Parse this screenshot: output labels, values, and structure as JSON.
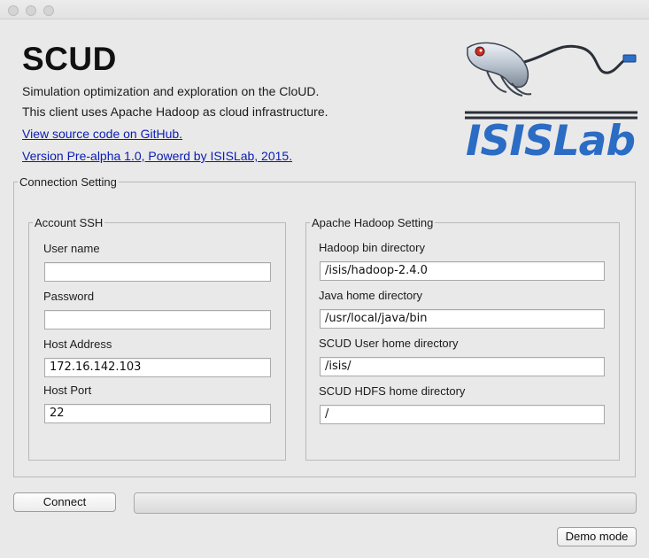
{
  "app": {
    "title": "SCUD",
    "description_line1": "Simulation optimization and exploration on the CloUD.",
    "description_line2": "This client uses Apache Hadoop as cloud infrastructure.",
    "link_github": "View source code on GitHub.",
    "link_version": "Version Pre-alpha 1.0, Powerd by ISISLab, 2015."
  },
  "logo": {
    "text": "ISISLab",
    "brand_color": "#2b6cc4"
  },
  "connection": {
    "group_label": "Connection Setting",
    "ssh": {
      "group_label": "Account SSH",
      "username_label": "User name",
      "username_value": "",
      "password_label": "Password",
      "password_value": "",
      "host_label": "Host Address",
      "host_value": "172.16.142.103",
      "port_label": "Host Port",
      "port_value": "22"
    },
    "hadoop": {
      "group_label": "Apache Hadoop Setting",
      "bin_label": "Hadoop bin directory",
      "bin_value": "/isis/hadoop-2.4.0",
      "java_label": "Java home directory",
      "java_value": "/usr/local/java/bin",
      "user_home_label": "SCUD User home directory",
      "user_home_value": "/isis/",
      "hdfs_home_label": "SCUD HDFS home directory",
      "hdfs_home_value": "/"
    }
  },
  "actions": {
    "connect_label": "Connect",
    "demo_label": "Demo mode",
    "progress_fraction": 0
  },
  "colors": {
    "link": "#0a1bb4",
    "window_bg": "#e9e9e9"
  }
}
